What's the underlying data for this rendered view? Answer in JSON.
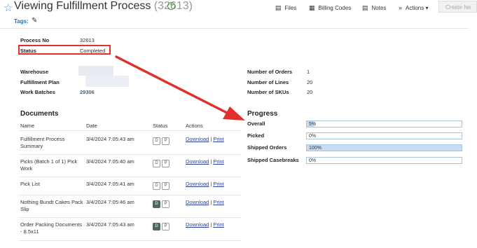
{
  "header": {
    "title": "Viewing Fulfillment Process",
    "process_number": "(32613)",
    "toolbar": {
      "files": "Files",
      "billing_codes": "Billing Codes",
      "notes": "Notes",
      "actions": "Actions ▾",
      "create": "Create Ne"
    },
    "tags_label": "Tags:"
  },
  "info": {
    "process_no_label": "Process No",
    "process_no_value": "32613",
    "status_label": "Status",
    "status_value": "Completed",
    "warehouse_label": "Warehouse",
    "fulfillment_plan_label": "Fulfillment Plan",
    "work_batches_label": "Work Batches",
    "work_batches_value": "29306"
  },
  "counts": {
    "orders_label": "Number of Orders",
    "orders_value": "1",
    "lines_label": "Number of Lines",
    "lines_value": "20",
    "skus_label": "Number of SKUs",
    "skus_value": "20"
  },
  "documents": {
    "heading": "Documents",
    "columns": [
      "Name",
      "Date",
      "Status",
      "Actions"
    ],
    "download": "Download",
    "separator": "|",
    "print": "Print",
    "rows": [
      {
        "name": "Fulfillment Process Summary",
        "date": "3/4/2024 7:05:43 am",
        "d": "D",
        "p": "P",
        "d_dark": false
      },
      {
        "name": "Picks (Batch 1 of 1) Pick Work",
        "date": "3/4/2024 7:05:40 am",
        "d": "D",
        "p": "P",
        "d_dark": false
      },
      {
        "name": "Pick List",
        "date": "3/4/2024 7:05:41 am",
        "d": "D",
        "p": "P",
        "d_dark": false
      },
      {
        "name": "Nothing Bundt Cakes Pack Slip",
        "date": "3/4/2024 7:05:46 am",
        "d": "D",
        "p": "P",
        "d_dark": true
      },
      {
        "name": "Order Packing Documents - 8.5x11",
        "date": "3/4/2024 7:05:43 am",
        "d": "D",
        "p": "P",
        "d_dark": true
      }
    ]
  },
  "progress": {
    "heading": "Progress",
    "items": [
      {
        "label": "Overall",
        "text": "5%",
        "value": 0.05
      },
      {
        "label": "Picked",
        "text": "0%",
        "value": 0
      },
      {
        "label": "Shipped Orders",
        "text": "100%",
        "value": 1.0
      },
      {
        "label": "Shipped Casebreaks",
        "text": "0%",
        "value": 0
      }
    ]
  },
  "colors": {
    "annotation": "#e0302a",
    "link": "#2b6cb0",
    "progress_fill": "#c6dcf2"
  }
}
